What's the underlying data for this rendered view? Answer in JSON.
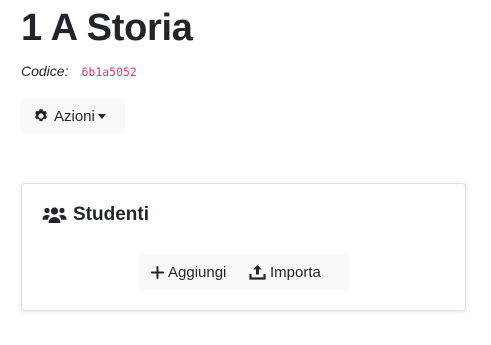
{
  "page": {
    "title": "1 A Storia",
    "code_label": "Codice:",
    "code_value": "6b1a5052"
  },
  "actions": {
    "label": "Azioni",
    "icon": "gear-icon"
  },
  "students_card": {
    "title": "Studenti",
    "icon": "users-icon",
    "add_label": "Aggiungi",
    "add_icon": "plus-icon",
    "import_label": "Importa",
    "import_icon": "upload-icon"
  },
  "colors": {
    "code_accent": "#d63384",
    "button_bg": "#f8f9fa",
    "text": "#212529"
  }
}
